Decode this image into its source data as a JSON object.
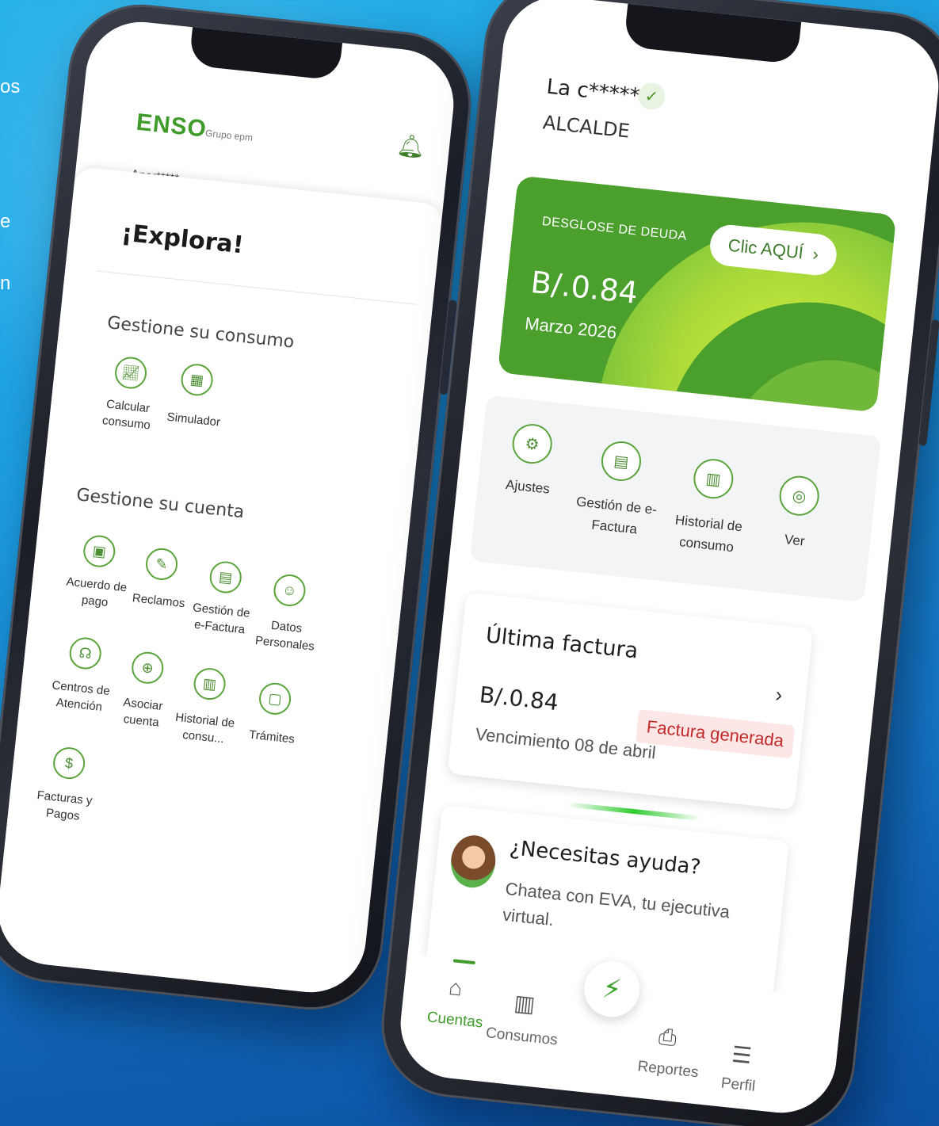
{
  "background": {
    "accent": "#1c9ee0",
    "brand_green": "#3f9b2a"
  },
  "edge_text": [
    "os",
    "e",
    "n"
  ],
  "left_phone": {
    "logo": "ENSO",
    "group": "Grupo epm",
    "bell_icon": "bell-icon",
    "account_mask": "Anar*****",
    "title": "¡Explora!",
    "consumo_section": {
      "title": "Gestione su consumo",
      "items": [
        {
          "label": "Calcular consumo",
          "icon": "chart-icon"
        },
        {
          "label": "Simulador",
          "icon": "calculator-icon"
        }
      ]
    },
    "cuenta_section": {
      "title": "Gestione su cuenta",
      "items": [
        {
          "label": "Acuerdo de pago",
          "icon": "wallet-icon"
        },
        {
          "label": "Reclamos",
          "icon": "edit-document-icon"
        },
        {
          "label": "Gestión de e-Factura",
          "icon": "efactura-icon"
        },
        {
          "label": "Datos Personales",
          "icon": "user-icon"
        },
        {
          "label": "Centros de Atención",
          "icon": "headset-icon"
        },
        {
          "label": "Asociar cuenta",
          "icon": "add-user-icon"
        },
        {
          "label": "Historial de consu...",
          "icon": "history-chart-icon"
        },
        {
          "label": "Trámites",
          "icon": "clipboard-icon"
        },
        {
          "label": "Facturas y Pagos",
          "icon": "invoice-icon"
        }
      ]
    }
  },
  "right_phone": {
    "account_name": "La c*****",
    "account_sub": "ALCALDE",
    "debt_card": {
      "title": "DESGLOSE DE DEUDA",
      "amount": "B/.0.84",
      "period": "Marzo 2026",
      "cta": "Clic AQUÍ"
    },
    "quick_actions": [
      {
        "label": "Ajustes",
        "icon": "gear-icon"
      },
      {
        "label": "Gestión de e-Factura",
        "icon": "efactura-icon"
      },
      {
        "label": "Historial de consumo",
        "icon": "history-chart-icon"
      },
      {
        "label": "Ver",
        "icon": "location-icon"
      }
    ],
    "last_invoice": {
      "title": "Última factura",
      "amount": "B/.0.84",
      "due": "Vencimiento 08 de abril",
      "status": "Factura generada"
    },
    "help": {
      "title": "¿Necesitas ayuda?",
      "text": "Chatea con EVA, tu ejecutiva virtual."
    },
    "nav": [
      {
        "label": "Cuentas",
        "icon": "home-icon",
        "active": true
      },
      {
        "label": "Consumos",
        "icon": "bar-chart-icon"
      },
      {
        "label": "Reportes",
        "icon": "report-icon"
      },
      {
        "label": "Perfil",
        "icon": "menu-icon"
      }
    ],
    "fab_icon": "bolt-icon"
  }
}
